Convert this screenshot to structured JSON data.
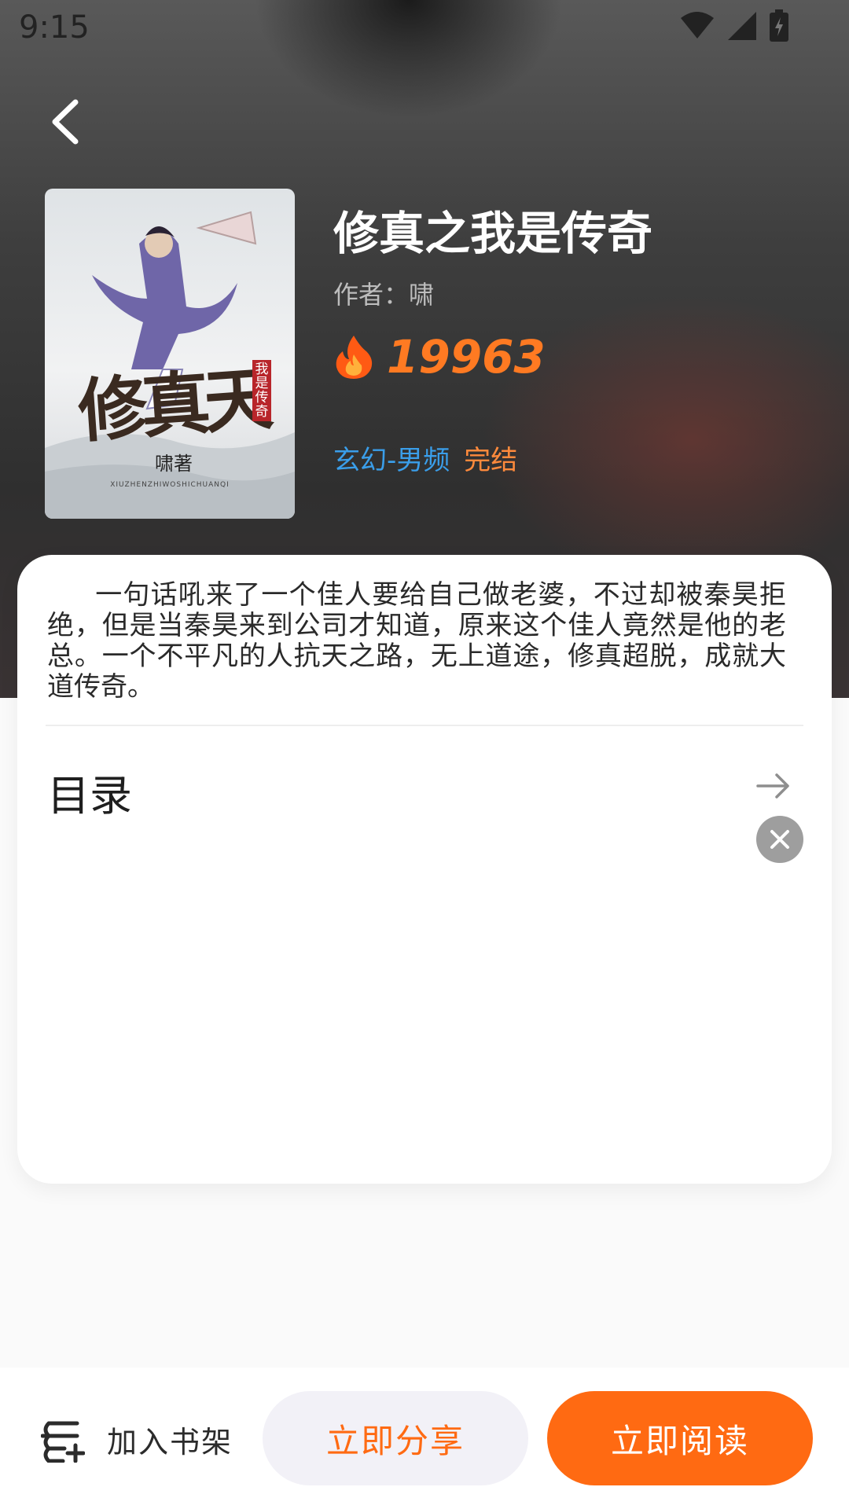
{
  "status_bar": {
    "time": "9:15",
    "icons": [
      "wifi-icon",
      "signal-icon",
      "battery-charging-icon"
    ]
  },
  "header": {
    "back_icon": "chevron-left-icon"
  },
  "book": {
    "cover": {
      "title_art": "修真天",
      "subtitle_art": "我是传奇",
      "author_art": "啸著",
      "pinyin_art": "XIUZHENZHIWOSHICHUANQI"
    },
    "title": "修真之我是传奇",
    "author_label": "作者：",
    "author_name": "啸",
    "heat_icon": "fire-icon",
    "heat_value": "19963",
    "category": "玄幻-男频",
    "status": "完结"
  },
  "detail": {
    "intro": "一句话吼来了一个佳人要给自己做老婆，不过却被秦昊拒绝，但是当秦昊来到公司才知道，原来这个佳人竟然是他的老总。一个不平凡的人抗天之路，无上道途，修真超脱，成就大道传奇。",
    "toc_label": "目录",
    "toc_arrow_icon": "arrow-right-icon",
    "close_icon": "close-icon"
  },
  "bottom_bar": {
    "shelf_icon": "add-to-shelf-icon",
    "shelf_label": "加入书架",
    "share_label": "立即分享",
    "read_label": "立即阅读"
  },
  "colors": {
    "accent": "#ff6a12",
    "category": "#3a9eea",
    "status": "#ff8a3c",
    "heat": "#ff7a22"
  }
}
